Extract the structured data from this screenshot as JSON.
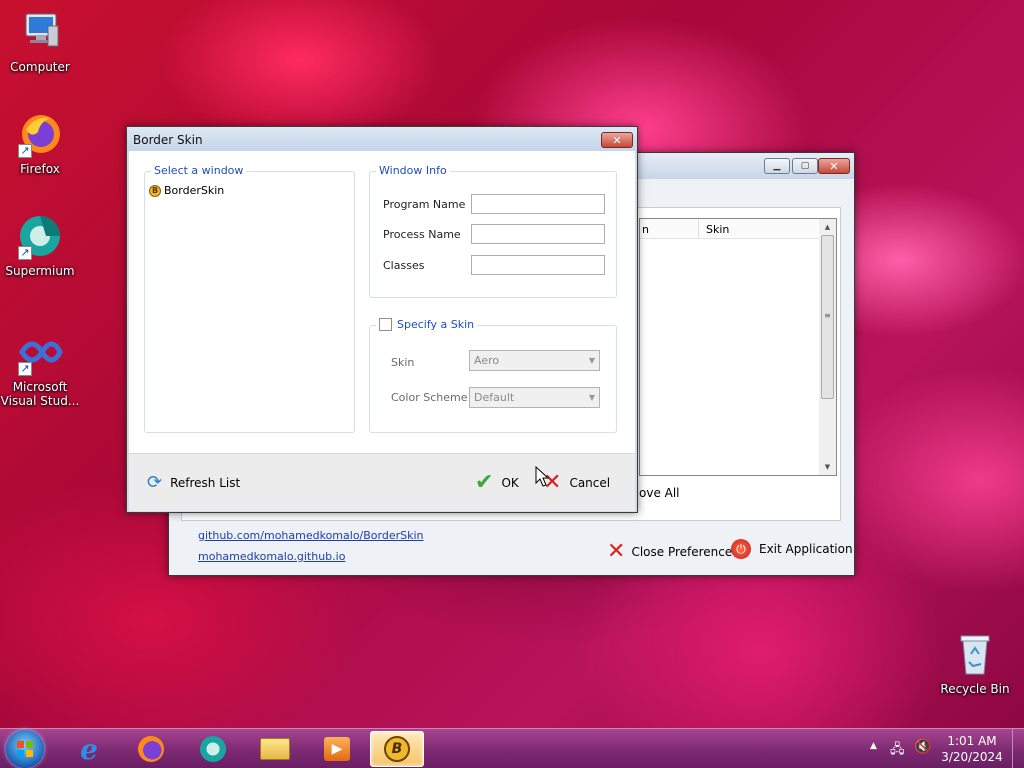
{
  "desktop": {
    "icons": [
      {
        "label": "Computer",
        "icon": "computer-icon"
      },
      {
        "label": "Firefox",
        "icon": "firefox-icon"
      },
      {
        "label": "Supermium",
        "icon": "supermium-icon"
      },
      {
        "label": "Microsoft Visual Stud...",
        "icon": "visual-studio-icon"
      },
      {
        "label": "Recycle Bin",
        "icon": "recycle-bin-icon"
      }
    ]
  },
  "main_window": {
    "list_columns": [
      "n",
      "Skin"
    ],
    "remove_all_partial": "ove All",
    "links": [
      "github.com/mohamedkomalo/BorderSkin",
      "mohamedkomalo.github.io"
    ],
    "close_preference_label": "Close Preference",
    "exit_application_label": "Exit Application"
  },
  "dialog": {
    "title": "Border Skin",
    "select_window_title": "Select a window",
    "windows_list": [
      {
        "label": "BorderSkin",
        "icon": "borderskin-icon"
      }
    ],
    "window_info_title": "Window Info",
    "program_name_label": "Program Name",
    "program_name_value": "",
    "process_name_label": "Process Name",
    "process_name_value": "",
    "classes_label": "Classes",
    "classes_value": "",
    "specify_skin_label": "Specify a Skin",
    "specify_skin_checked": false,
    "skin_label": "Skin",
    "skin_value": "Aero",
    "color_scheme_label": "Color Scheme",
    "color_scheme_value": "Default",
    "refresh_label": "Refresh List",
    "ok_label": "OK",
    "cancel_label": "Cancel"
  },
  "taskbar": {
    "pinned": [
      "internet-explorer-icon",
      "firefox-icon",
      "supermium-icon",
      "explorer-icon",
      "media-player-icon",
      "borderskin-icon"
    ],
    "time": "1:01 AM",
    "date": "3/20/2024"
  }
}
